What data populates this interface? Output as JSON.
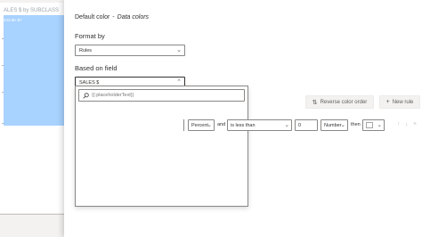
{
  "background_visual": {
    "title": "ALES $ by SUBCLASS",
    "bar_label": "243.8K $7",
    "bar_color": "#a8d2ff"
  },
  "dialog": {
    "breadcrumb": {
      "parent": "Default color",
      "separator": "-",
      "current": "Data colors"
    },
    "format_by": {
      "label": "Format by",
      "value": "Rules"
    },
    "based_on_field": {
      "label": "Based on field",
      "value": "SALES $"
    },
    "field_panel": {
      "search_placeholder": "{{:placeholderText}}"
    },
    "buttons": {
      "reverse_color_order": "Reverse color order",
      "reverse_icon": "swap-vertical-icon",
      "new_rule": "New rule",
      "new_rule_icon": "plus-icon"
    },
    "rule": {
      "value_type": "Percent",
      "and_label": "and",
      "operator": "is less than",
      "value": "0",
      "value_unit": "Number",
      "then_label": "then",
      "color": "#ffffff"
    },
    "accent_color": "#0078d4"
  }
}
